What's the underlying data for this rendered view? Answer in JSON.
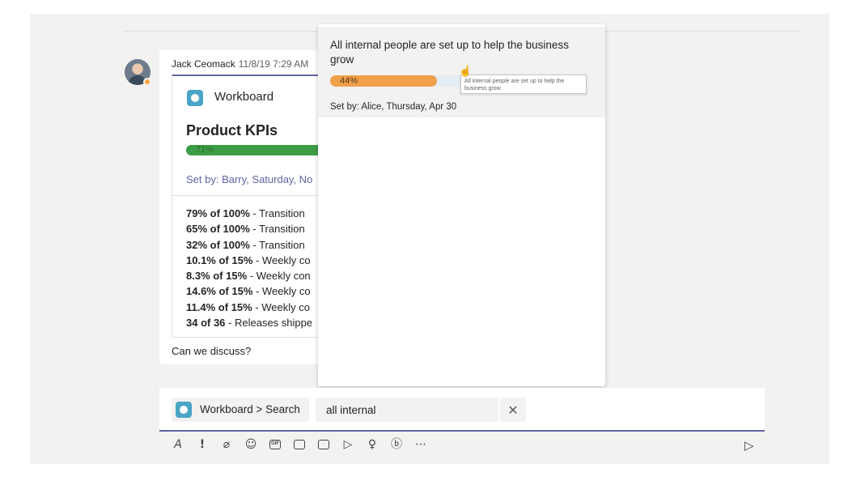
{
  "message": {
    "author": "Jack Ceomack",
    "timestamp": "11/8/19 7:29 AM",
    "card": {
      "app_name": "Workboard",
      "title": "Product KPIs",
      "progress_label": "71%",
      "progress_fraction": 0.71,
      "set_by": "Set by: Barry, Saturday, No",
      "kpis": [
        {
          "value": "79% of 100%",
          "text": " - Transition"
        },
        {
          "value": "65% of 100%",
          "text": " - Transition"
        },
        {
          "value": "32% of 100%",
          "text": " - Transition"
        },
        {
          "value": "10.1% of 15%",
          "text": " - Weekly co"
        },
        {
          "value": "8.3% of 15%",
          "text": " - Weekly con"
        },
        {
          "value": "14.6% of 15%",
          "text": " - Weekly co"
        },
        {
          "value": "11.4% of 15%",
          "text": " - Weekly co"
        },
        {
          "value": "34 of 36",
          "text": " - Releases shippe"
        }
      ]
    },
    "body": "Can we discuss?"
  },
  "popup": {
    "result": {
      "title": "All internal people are set up to help the business grow",
      "progress_label": "44%",
      "progress_fraction": 0.44,
      "set_by": "Set by: Alice, Thursday, Apr 30",
      "tooltip": "All internal people are set up to help the business grow"
    }
  },
  "compose": {
    "chip_label": "Workboard > Search",
    "search_value": "all internal",
    "close_glyph": "✕"
  },
  "toolbar": {
    "format": "A",
    "important": "!",
    "gif": "GIF"
  },
  "colors": {
    "accent": "#6264a7",
    "kpi_green": "#3d9d45",
    "result_orange": "#f09f4b",
    "presence_away": "#f8a33b"
  }
}
